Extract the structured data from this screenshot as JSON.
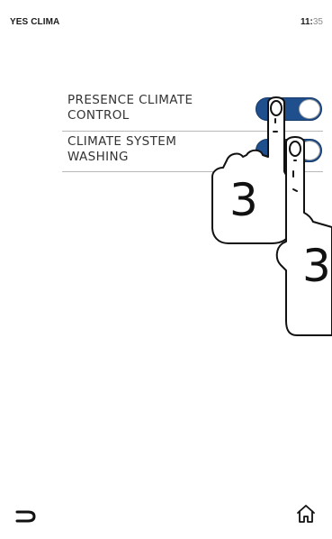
{
  "status_bar": {
    "app_title": "YES CLIMA",
    "clock_hours": "11:",
    "clock_minutes": "35"
  },
  "settings": [
    {
      "label": "PRESENCE CLIMATE\nCONTROL",
      "toggle_state": "on"
    },
    {
      "label": "CLIMATE SYSTEM\nWASHING",
      "toggle_state": "on"
    }
  ],
  "gesture": {
    "finger_count_primary": "3",
    "finger_count_secondary": "3"
  },
  "navigation": {
    "back_icon": "back-arrow-icon",
    "home_icon": "home-icon"
  },
  "colors": {
    "toggle_on": "#1f4f8c",
    "divider": "#b8b8b8"
  }
}
